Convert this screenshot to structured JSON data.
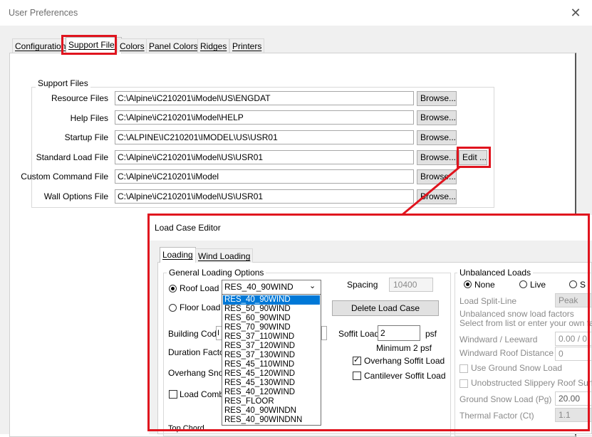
{
  "window": {
    "title": "User Preferences",
    "close_glyph": "✕"
  },
  "tabs": [
    "Configuration",
    "Support Files",
    "Colors",
    "Panel Colors",
    "Ridges",
    "Printers"
  ],
  "support_files": {
    "group_label": "Support Files",
    "rows": [
      {
        "label": "Resource Files",
        "value": "C:\\Alpine\\iC210201\\iModel\\US\\ENGDAT"
      },
      {
        "label": "Help Files",
        "value": "C:\\Alpine\\iC210201\\iModel\\HELP"
      },
      {
        "label": "Startup File",
        "value": "C:\\ALPINE\\IC210201\\IMODEL\\US\\USR01"
      },
      {
        "label": "Standard Load File",
        "value": "C:\\Alpine\\iC210201\\iModel\\US\\USR01"
      },
      {
        "label": "Custom Command File",
        "value": "C:\\Alpine\\iC210201\\iModel"
      },
      {
        "label": "Wall Options File",
        "value": "C:\\Alpine\\iC210201\\iModel\\US\\USR01"
      }
    ],
    "browse_label": "Browse...",
    "edit_label": "Edit ..."
  },
  "load_case_editor": {
    "title": "Load Case Editor",
    "tabs": [
      "Loading",
      "Wind Loading"
    ],
    "general_group": "General Loading Options",
    "roof_load": "Roof Load",
    "floor_load": "Floor Load",
    "selected_load": "RES_40_90WIND",
    "spacing_label": "Spacing",
    "spacing_value": "10400",
    "delete_button": "Delete Load Case",
    "building_code": "Building Code",
    "building_code_prefix": "I",
    "duration_factor": "Duration Factor",
    "overhang_snow": "Overhang Snow",
    "load_combi": "Load Combi",
    "soffit_load_label": "Soffit Load",
    "soffit_value": "2",
    "soffit_unit": "psf",
    "soffit_min": "Minimum 2 psf",
    "overhang_soffit": "Overhang Soffit Load",
    "cantilever_soffit": "Cantilever Soffit Load",
    "top_chord_partial": "Top Chord",
    "dropdown_items": [
      "RES_40_90WIND",
      "RES_50_90WIND",
      "RES_60_90WIND",
      "RES_70_90WIND",
      "RES_37_110WIND",
      "RES_37_120WIND",
      "RES_37_130WIND",
      "RES_45_110WIND",
      "RES_45_120WIND",
      "RES_45_130WIND",
      "RES_40_120WIND",
      "RES_FLOOR",
      "RES_40_90WINDN",
      "RES_40_90WINDNN"
    ],
    "unbalanced": {
      "group": "Unbalanced Loads",
      "none": "None",
      "live": "Live",
      "s_partial": "S",
      "split_line_label": "Load Split-Line",
      "split_line_value": "Peak",
      "factors_text": "Unbalanced snow load factors",
      "factors_hint": "Select from list or enter your own facto",
      "windward_label": "Windward / Leeward",
      "windward_value": "0.00 / 0",
      "windward_roof_label": "Windward Roof Distance",
      "windward_roof_value": "0",
      "use_ground": "Use Ground Snow Load",
      "unobstructed": "Unobstructed Slippery Roof Surfac",
      "ground_snow_label": "Ground Snow Load (Pg)",
      "ground_snow_value": "20.00",
      "thermal_label": "Thermal Factor (Ct)",
      "thermal_value": "1.1"
    }
  },
  "colors": {
    "highlight": "#e0141e",
    "selection": "#0078d7"
  }
}
